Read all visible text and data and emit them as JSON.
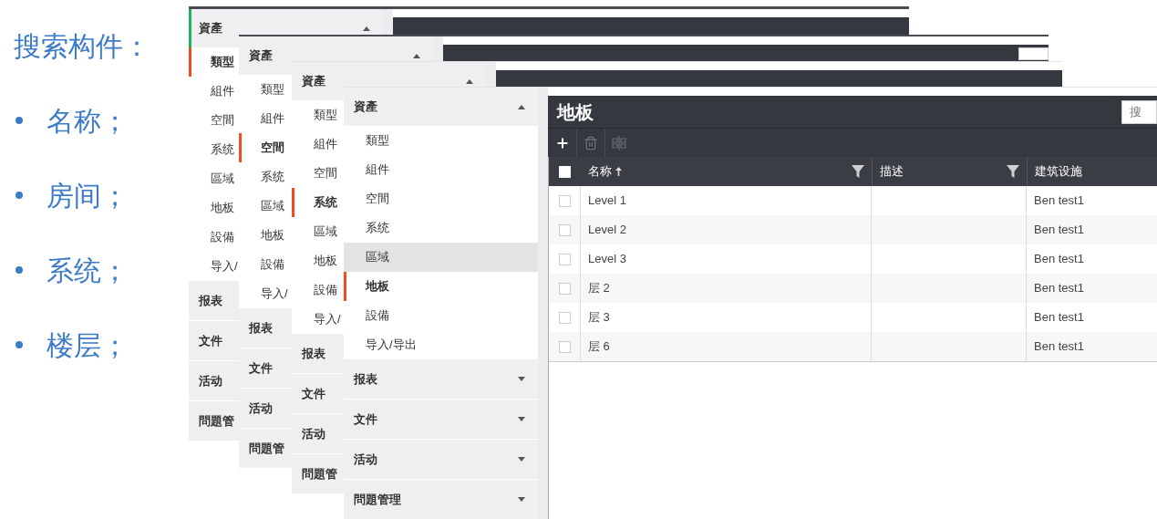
{
  "slide": {
    "title": "搜索构件：",
    "bullets": [
      {
        "text": "名称；"
      },
      {
        "text": "房间；"
      },
      {
        "text": "系统；"
      },
      {
        "text": "楼层；"
      }
    ]
  },
  "panels": [
    {
      "sidebar": {
        "sections": [
          {
            "label": "資產",
            "expanded": true,
            "items": [
              {
                "label": "類型",
                "selected": true,
                "hovered": false
              },
              {
                "label": "組件",
                "selected": false,
                "hovered": false
              },
              {
                "label": "空間",
                "selected": false,
                "hovered": false
              },
              {
                "label": "系统",
                "selected": false,
                "hovered": false
              },
              {
                "label": "區域",
                "selected": false,
                "hovered": false
              },
              {
                "label": "地板",
                "selected": false,
                "hovered": false
              },
              {
                "label": "設備",
                "selected": false,
                "hovered": false
              },
              {
                "label": "导入/",
                "selected": false,
                "hovered": false
              }
            ]
          },
          {
            "label": "报表",
            "expanded": false
          },
          {
            "label": "文件",
            "expanded": false
          },
          {
            "label": "活动",
            "expanded": false
          },
          {
            "label": "問題管",
            "expanded": false
          }
        ]
      },
      "content": {
        "title_bar": true
      }
    },
    {
      "sidebar": {
        "sections": [
          {
            "label": "資產",
            "expanded": true,
            "items": [
              {
                "label": "類型",
                "selected": false,
                "hovered": false
              },
              {
                "label": "組件",
                "selected": false,
                "hovered": false
              },
              {
                "label": "空間",
                "selected": true,
                "hovered": false
              },
              {
                "label": "系统",
                "selected": false,
                "hovered": false
              },
              {
                "label": "區域",
                "selected": false,
                "hovered": false
              },
              {
                "label": "地板",
                "selected": false,
                "hovered": false
              },
              {
                "label": "設備",
                "selected": false,
                "hovered": false
              },
              {
                "label": "导入/",
                "selected": false,
                "hovered": false
              }
            ]
          },
          {
            "label": "报表",
            "expanded": false
          },
          {
            "label": "文件",
            "expanded": false
          },
          {
            "label": "活动",
            "expanded": false
          },
          {
            "label": "問題管",
            "expanded": false
          }
        ]
      },
      "content": {
        "title_bar": true,
        "search": {
          "visible": true
        }
      }
    },
    {
      "sidebar": {
        "sections": [
          {
            "label": "資產",
            "expanded": true,
            "items": [
              {
                "label": "類型",
                "selected": false,
                "hovered": false
              },
              {
                "label": "組件",
                "selected": false,
                "hovered": false
              },
              {
                "label": "空間",
                "selected": false,
                "hovered": false
              },
              {
                "label": "系统",
                "selected": true,
                "hovered": false
              },
              {
                "label": "區域",
                "selected": false,
                "hovered": false
              },
              {
                "label": "地板",
                "selected": false,
                "hovered": false
              },
              {
                "label": "設備",
                "selected": false,
                "hovered": false
              },
              {
                "label": "导入/",
                "selected": false,
                "hovered": false
              }
            ]
          },
          {
            "label": "报表",
            "expanded": false
          },
          {
            "label": "文件",
            "expanded": false
          },
          {
            "label": "活动",
            "expanded": false
          },
          {
            "label": "問題管",
            "expanded": false
          }
        ]
      },
      "content": {
        "title_bar": true
      }
    },
    {
      "sidebar": {
        "sections": [
          {
            "label": "資產",
            "expanded": true,
            "items": [
              {
                "label": "類型",
                "selected": false,
                "hovered": false
              },
              {
                "label": "組件",
                "selected": false,
                "hovered": false
              },
              {
                "label": "空間",
                "selected": false,
                "hovered": false
              },
              {
                "label": "系统",
                "selected": false,
                "hovered": false
              },
              {
                "label": "區域",
                "selected": false,
                "hovered": true
              },
              {
                "label": "地板",
                "selected": true,
                "hovered": false
              },
              {
                "label": "設備",
                "selected": false,
                "hovered": false
              },
              {
                "label": "导入/导出",
                "selected": false,
                "hovered": false
              }
            ]
          },
          {
            "label": "报表",
            "expanded": false
          },
          {
            "label": "文件",
            "expanded": false
          },
          {
            "label": "活动",
            "expanded": false
          },
          {
            "label": "問題管理",
            "expanded": false
          }
        ]
      },
      "content": {
        "title_bar": true,
        "title": "地板",
        "search": {
          "visible": true,
          "placeholder": "搜"
        },
        "toolbar": [
          {
            "kind": "add",
            "disabled": false
          },
          {
            "kind": "delete",
            "disabled": true
          },
          {
            "kind": "columns",
            "disabled": true
          }
        ],
        "table": {
          "columns": [
            {
              "label": "名称",
              "sorted": true,
              "filter": true
            },
            {
              "label": "描述",
              "sorted": false,
              "filter": true
            },
            {
              "label": "建筑设施",
              "sorted": false,
              "filter": false
            }
          ],
          "select_all": {
            "checked": false
          },
          "rows": [
            {
              "checked": false,
              "cells": [
                "Level 1",
                "",
                "Ben test1"
              ]
            },
            {
              "checked": false,
              "cells": [
                "Level 2",
                "",
                "Ben test1"
              ]
            },
            {
              "checked": false,
              "cells": [
                "Level 3",
                "",
                "Ben test1"
              ]
            },
            {
              "checked": false,
              "cells": [
                "层 2",
                "",
                "Ben test1"
              ]
            },
            {
              "checked": false,
              "cells": [
                "层 3",
                "",
                "Ben test1"
              ]
            },
            {
              "checked": false,
              "cells": [
                "层 6",
                "",
                "Ben test1"
              ]
            }
          ]
        }
      }
    }
  ]
}
